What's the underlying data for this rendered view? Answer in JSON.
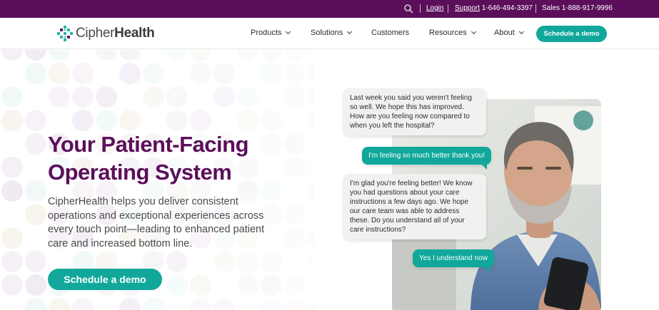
{
  "topbar": {
    "login": "Login",
    "support_label": "Support",
    "support_phone": "1-646-494-3397",
    "sales": "Sales 1-888-917-9996"
  },
  "logo": {
    "part1": "Cipher",
    "part2": "Health"
  },
  "nav": {
    "items": [
      {
        "label": "Products"
      },
      {
        "label": "Solutions"
      },
      {
        "label": "Customers"
      },
      {
        "label": "Resources"
      },
      {
        "label": "About"
      }
    ],
    "cta": "Schedule a demo"
  },
  "hero": {
    "headline": "Your Patient-Facing Operating System",
    "lead": "CipherHealth helps you deliver consistent operations and exceptional experiences across every touch point—leading to enhanced patient care and increased bottom line.",
    "cta": "Schedule a demo"
  },
  "chat": [
    {
      "from": "system",
      "text": "Last week you said you weren't feeling so well. We hope this has improved. How are you feeling now compared to when you left the hospital?"
    },
    {
      "from": "patient",
      "text": "I'm feeling so much better thank you!"
    },
    {
      "from": "system",
      "text": "I'm glad you're feeling better! We know you had questions about your care instructions a few days ago. We hope our care team was able to address these. Do you understand all of your care instructions?"
    },
    {
      "from": "patient",
      "text": "Yes I understand now"
    }
  ],
  "colors": {
    "brand_purple": "#5b0f5a",
    "accent_teal": "#11a89b"
  }
}
